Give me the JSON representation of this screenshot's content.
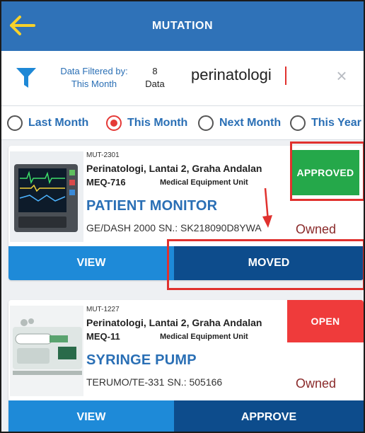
{
  "header": {
    "title": "MUTATION"
  },
  "filter": {
    "label_line1": "Data Filtered by:",
    "label_line2": "This Month",
    "count_value": "8",
    "count_unit": "Data",
    "search_value": "perinatologi"
  },
  "periods": [
    {
      "label": "Last Month",
      "selected": false
    },
    {
      "label": "This Month",
      "selected": true
    },
    {
      "label": "Next Month",
      "selected": false
    },
    {
      "label": "This Year",
      "selected": false
    }
  ],
  "cards": [
    {
      "code": "MUT-2301",
      "location": "Perinatologi, Lantai 2, Graha Andalan",
      "meq": "MEQ-716",
      "unit": "Medical Equipment Unit",
      "name": "PATIENT MONITOR",
      "serial": "GE/DASH 2000  SN.: SK218090D8YWA",
      "ownership": "Owned",
      "status": "APPROVED",
      "view_label": "VIEW",
      "action_label": "MOVED"
    },
    {
      "code": "MUT-1227",
      "location": "Perinatologi, Lantai 2, Graha Andalan",
      "meq": "MEQ-11",
      "unit": "Medical Equipment Unit",
      "name": "SYRINGE PUMP",
      "serial": "TERUMO/TE-331  SN.: 505166",
      "ownership": "Owned",
      "status": "OPEN",
      "view_label": "VIEW",
      "action_label": "APPROVE"
    }
  ],
  "colors": {
    "header": "#2f72b8",
    "accent_blue": "#2a6fb5",
    "approved": "#25a84a",
    "open": "#ef3b3b",
    "view_button": "#1e8ad8",
    "action_button": "#0d4c8c",
    "highlight": "#e0312e"
  }
}
